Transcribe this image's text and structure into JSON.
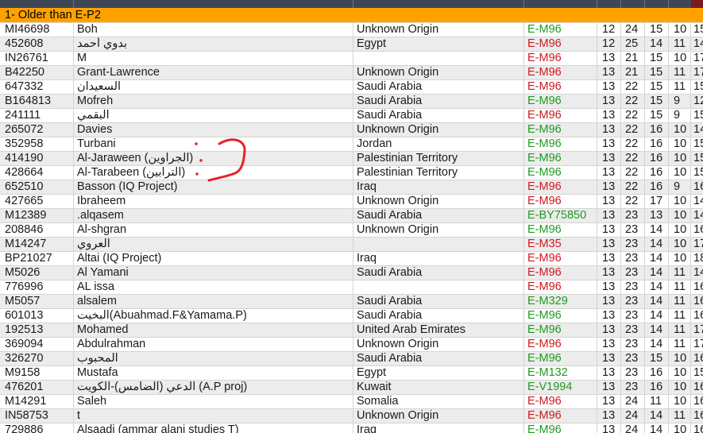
{
  "group_header": "1- Older than E-P2",
  "colors": {
    "header_bg": "#ffa200",
    "red_code": "#d0181e",
    "green_code": "#1f9a1f",
    "annotation": "#e3232b"
  },
  "rows": [
    {
      "id": "MI46698",
      "name": "Boh",
      "origin": "Unknown Origin",
      "code": "E-M96",
      "code_color": "green",
      "n1": "12",
      "n2": "24",
      "n3": "15",
      "n4": "10",
      "n5": "15"
    },
    {
      "id": "452608",
      "name": "بدوي أحمد",
      "origin": "Egypt",
      "code": "E-M96",
      "code_color": "red",
      "n1": "12",
      "n2": "25",
      "n3": "14",
      "n4": "11",
      "n5": "14"
    },
    {
      "id": "IN26761",
      "name": "M",
      "origin": "",
      "code": "E-M96",
      "code_color": "red",
      "n1": "13",
      "n2": "21",
      "n3": "15",
      "n4": "10",
      "n5": "17"
    },
    {
      "id": "B42250",
      "name": "Grant-Lawrence",
      "origin": "Unknown Origin",
      "code": "E-M96",
      "code_color": "red",
      "n1": "13",
      "n2": "21",
      "n3": "15",
      "n4": "11",
      "n5": "17"
    },
    {
      "id": "647332",
      "name": "السعيدان",
      "origin": "Saudi Arabia",
      "code": "E-M96",
      "code_color": "red",
      "n1": "13",
      "n2": "22",
      "n3": "15",
      "n4": "11",
      "n5": "15"
    },
    {
      "id": "B164813",
      "name": "Mofreh",
      "origin": "Saudi Arabia",
      "code": "E-M96",
      "code_color": "green",
      "n1": "13",
      "n2": "22",
      "n3": "15",
      "n4": "9",
      "n5": "12"
    },
    {
      "id": "241111",
      "name": "البقمي",
      "origin": "Saudi Arabia",
      "code": "E-M96",
      "code_color": "red",
      "n1": "13",
      "n2": "22",
      "n3": "15",
      "n4": "9",
      "n5": "15"
    },
    {
      "id": "265072",
      "name": "Davies",
      "origin": "Unknown Origin",
      "code": "E-M96",
      "code_color": "green",
      "n1": "13",
      "n2": "22",
      "n3": "16",
      "n4": "10",
      "n5": "14"
    },
    {
      "id": "352958",
      "name": "Turbani",
      "origin": "Jordan",
      "code": "E-M96",
      "code_color": "green",
      "n1": "13",
      "n2": "22",
      "n3": "16",
      "n4": "10",
      "n5": "15"
    },
    {
      "id": "414190",
      "name": "Al-Jaraween (الجراوين)",
      "origin": "Palestinian Territory",
      "code": "E-M96",
      "code_color": "green",
      "n1": "13",
      "n2": "22",
      "n3": "16",
      "n4": "10",
      "n5": "15"
    },
    {
      "id": "428664",
      "name": "Al-Tarabeen (الترابين)",
      "origin": "Palestinian Territory",
      "code": "E-M96",
      "code_color": "green",
      "n1": "13",
      "n2": "22",
      "n3": "16",
      "n4": "10",
      "n5": "15"
    },
    {
      "id": "652510",
      "name": "Basson (IQ Project)",
      "origin": "Iraq",
      "code": "E-M96",
      "code_color": "red",
      "n1": "13",
      "n2": "22",
      "n3": "16",
      "n4": "9",
      "n5": "16"
    },
    {
      "id": "427665",
      "name": "Ibraheem",
      "origin": "Unknown Origin",
      "code": "E-M96",
      "code_color": "red",
      "n1": "13",
      "n2": "22",
      "n3": "17",
      "n4": "10",
      "n5": "14"
    },
    {
      "id": "M12389",
      "name": ".alqasem",
      "origin": "Saudi Arabia",
      "code": "E-BY75850",
      "code_color": "green",
      "n1": "13",
      "n2": "23",
      "n3": "13",
      "n4": "10",
      "n5": "14"
    },
    {
      "id": "208846",
      "name": "Al-shgran",
      "origin": "Unknown Origin",
      "code": "E-M96",
      "code_color": "green",
      "n1": "13",
      "n2": "23",
      "n3": "14",
      "n4": "10",
      "n5": "16"
    },
    {
      "id": "M14247",
      "name": "العروي",
      "origin": "",
      "code": "E-M35",
      "code_color": "red",
      "n1": "13",
      "n2": "23",
      "n3": "14",
      "n4": "10",
      "n5": "17"
    },
    {
      "id": "BP21027",
      "name": "Altai (IQ Project)",
      "origin": "Iraq",
      "code": "E-M96",
      "code_color": "red",
      "n1": "13",
      "n2": "23",
      "n3": "14",
      "n4": "10",
      "n5": "18"
    },
    {
      "id": "M5026",
      "name": "Al Yamani",
      "origin": "Saudi Arabia",
      "code": "E-M96",
      "code_color": "red",
      "n1": "13",
      "n2": "23",
      "n3": "14",
      "n4": "11",
      "n5": "14"
    },
    {
      "id": "776996",
      "name": "AL issa",
      "origin": "",
      "code": "E-M96",
      "code_color": "red",
      "n1": "13",
      "n2": "23",
      "n3": "14",
      "n4": "11",
      "n5": "16"
    },
    {
      "id": "M5057",
      "name": "alsalem",
      "origin": "Saudi Arabia",
      "code": "E-M329",
      "code_color": "green",
      "n1": "13",
      "n2": "23",
      "n3": "14",
      "n4": "11",
      "n5": "16"
    },
    {
      "id": "601013",
      "name": "البخيت(Abuahmad.F&Yamama.P)",
      "origin": "Saudi Arabia",
      "code": "E-M96",
      "code_color": "green",
      "n1": "13",
      "n2": "23",
      "n3": "14",
      "n4": "11",
      "n5": "16"
    },
    {
      "id": "192513",
      "name": "Mohamed",
      "origin": "United Arab Emirates",
      "code": "E-M96",
      "code_color": "green",
      "n1": "13",
      "n2": "23",
      "n3": "14",
      "n4": "11",
      "n5": "17"
    },
    {
      "id": "369094",
      "name": "Abdulrahman",
      "origin": "Unknown Origin",
      "code": "E-M96",
      "code_color": "red",
      "n1": "13",
      "n2": "23",
      "n3": "14",
      "n4": "11",
      "n5": "17"
    },
    {
      "id": "326270",
      "name": "المحبوب",
      "origin": "Saudi Arabia",
      "code": "E-M96",
      "code_color": "green",
      "n1": "13",
      "n2": "23",
      "n3": "15",
      "n4": "10",
      "n5": "16"
    },
    {
      "id": "M9158",
      "name": "Mustafa",
      "origin": "Egypt",
      "code": "E-M132",
      "code_color": "green",
      "n1": "13",
      "n2": "23",
      "n3": "16",
      "n4": "10",
      "n5": "15"
    },
    {
      "id": "476201",
      "name": "الدعي (الضامس)-الكويت (A.P proj)",
      "origin": "Kuwait",
      "code": "E-V1994",
      "code_color": "green",
      "n1": "13",
      "n2": "23",
      "n3": "16",
      "n4": "10",
      "n5": "16"
    },
    {
      "id": "M14291",
      "name": "Saleh",
      "origin": "Somalia",
      "code": "E-M96",
      "code_color": "red",
      "n1": "13",
      "n2": "24",
      "n3": "11",
      "n4": "10",
      "n5": "16"
    },
    {
      "id": "IN58753",
      "name": "t",
      "origin": "Unknown Origin",
      "code": "E-M96",
      "code_color": "red",
      "n1": "13",
      "n2": "24",
      "n3": "14",
      "n4": "11",
      "n5": "16"
    },
    {
      "id": "729886",
      "name": "Alsaadi (ammar alani studies T)",
      "origin": "Iraq",
      "code": "E-M96",
      "code_color": "green",
      "n1": "13",
      "n2": "24",
      "n3": "14",
      "n4": "10",
      "n5": "16"
    }
  ]
}
